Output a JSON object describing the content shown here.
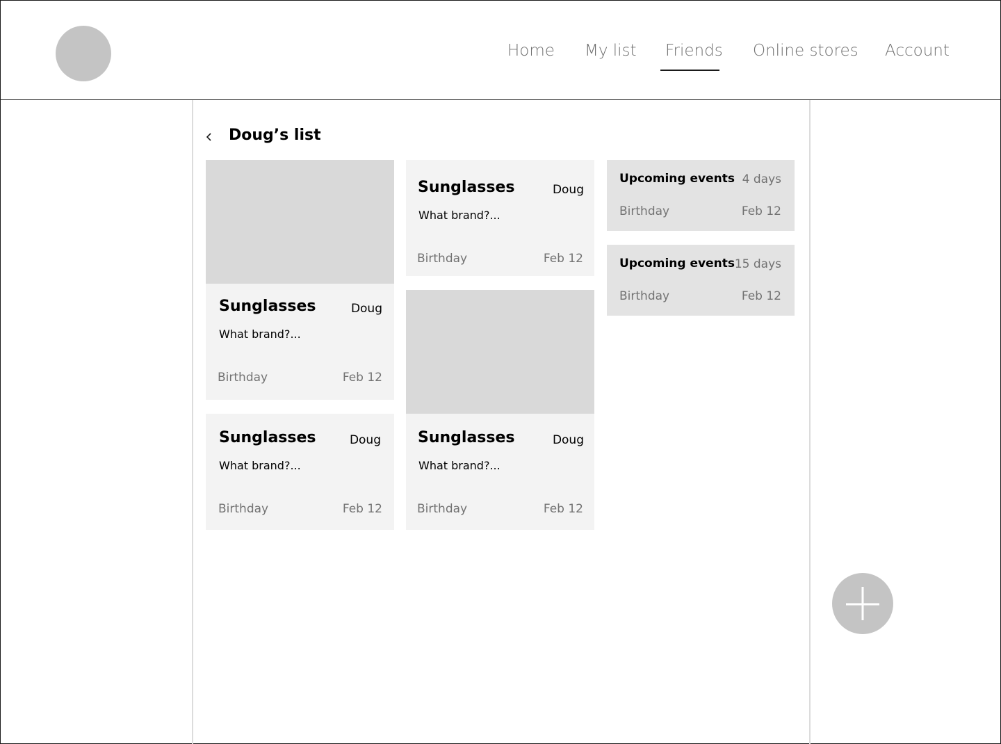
{
  "header": {
    "logo_icon": "circle-avatar-placeholder",
    "nav": [
      {
        "label": "Home"
      },
      {
        "label": "My list"
      },
      {
        "label": "Friends",
        "active": true
      },
      {
        "label": "Online stores"
      },
      {
        "label": "Account"
      }
    ]
  },
  "page": {
    "back_icon": "chevron-left-icon",
    "title": "Doug’s list"
  },
  "items": [
    {
      "title": "Sunglasses",
      "owner": "Doug",
      "description": "What brand?...",
      "event": "Birthday",
      "date": "Feb 12",
      "has_image": true
    },
    {
      "title": "Sunglasses",
      "owner": "Doug",
      "description": "What brand?...",
      "event": "Birthday",
      "date": "Feb 12",
      "has_image": false
    },
    {
      "title": "Sunglasses",
      "owner": "Doug",
      "description": "What brand?...",
      "event": "Birthday",
      "date": "Feb 12",
      "has_image": false
    },
    {
      "title": "Sunglasses",
      "owner": "Doug",
      "description": "What brand?...",
      "event": "Birthday",
      "date": "Feb 12",
      "has_image": true
    }
  ],
  "events": [
    {
      "title": "Upcoming events",
      "countdown": "4 days",
      "name": "Birthday",
      "date": "Feb 12"
    },
    {
      "title": "Upcoming events",
      "countdown": "15 days",
      "name": "Birthday",
      "date": "Feb 12"
    }
  ],
  "fab": {
    "icon": "plus-icon"
  },
  "colors": {
    "placeholder": "#c4c4c4",
    "card_bg": "#f3f3f3",
    "image_bg": "#d9d9d9",
    "event_bg": "#e3e3e3",
    "muted_text": "#727272",
    "nav_text": "#6f6f6f"
  }
}
